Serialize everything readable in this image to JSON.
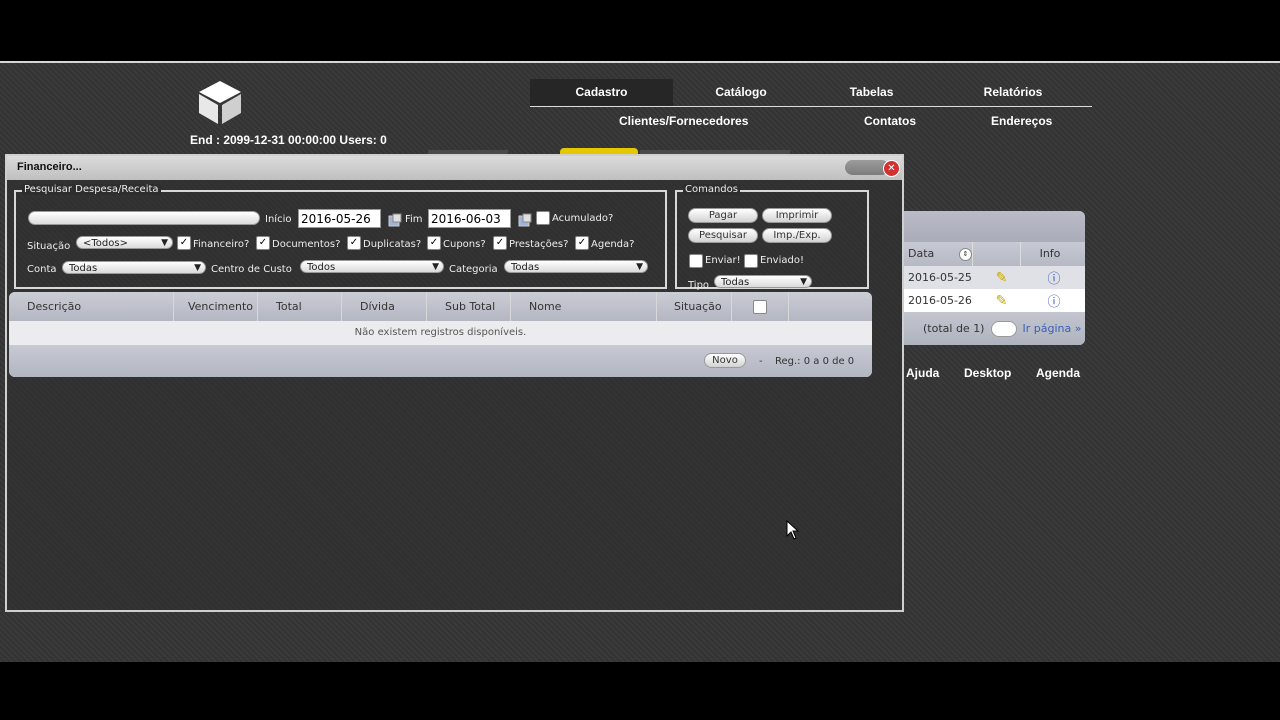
{
  "header": {
    "end_info": "End : 2099-12-31 00:00:00 Users: 0",
    "nav_tabs": [
      {
        "label": "Cadastro",
        "active": true
      },
      {
        "label": "Catálogo",
        "active": false
      },
      {
        "label": "Tabelas",
        "active": false
      },
      {
        "label": "Relatórios",
        "active": false
      }
    ],
    "sub_nav": [
      "Clientes/Fornecedores",
      "Contatos",
      "Endereços"
    ]
  },
  "background_panel": {
    "columns": [
      "Data",
      "Info"
    ],
    "rows": [
      {
        "date": "2016-05-25"
      },
      {
        "date": "2016-05-26"
      }
    ],
    "total": "(total de 1)",
    "goto": "Ir página »"
  },
  "bottom_menu": [
    "Ajuda",
    "Desktop",
    "Agenda"
  ],
  "dialog": {
    "title": "Financeiro...",
    "search_box": {
      "legend": "Pesquisar Despesa/Receita",
      "inicio_label": "Início",
      "inicio_value": "2016-05-26",
      "fim_label": "Fim",
      "fim_value": "2016-06-03",
      "acumulado_label": "Acumulado?",
      "situacao_label": "Situação",
      "situacao_value": "<Todos>",
      "checks": [
        "Financeiro?",
        "Documentos?",
        "Duplicatas?",
        "Cupons?",
        "Prestações?",
        "Agenda?"
      ],
      "conta_label": "Conta",
      "conta_value": "Todas",
      "centro_label": "Centro de Custo",
      "centro_value": "Todos",
      "categoria_label": "Categoria",
      "categoria_value": "Todas"
    },
    "commands": {
      "legend": "Comandos",
      "pagar": "Pagar",
      "imprimir": "Imprimir",
      "pesquisar": "Pesquisar",
      "impexp": "Imp./Exp.",
      "enviar": "Enviar!",
      "enviado": "Enviado!",
      "tipo_label": "Tipo",
      "tipo_value": "Todas"
    },
    "grid": {
      "columns": [
        "Descrição",
        "Vencimento",
        "Total",
        "Dívida",
        "Sub Total",
        "Nome",
        "Situação"
      ],
      "empty_message": "Não existem registros disponíveis.",
      "new_button": "Novo",
      "separator": "-",
      "reg_info": "Reg.: 0 a 0 de 0"
    }
  },
  "colors": {
    "accent_yellow": "#e6c800",
    "close_red": "#d23131",
    "link_blue": "#3b5fb5"
  }
}
